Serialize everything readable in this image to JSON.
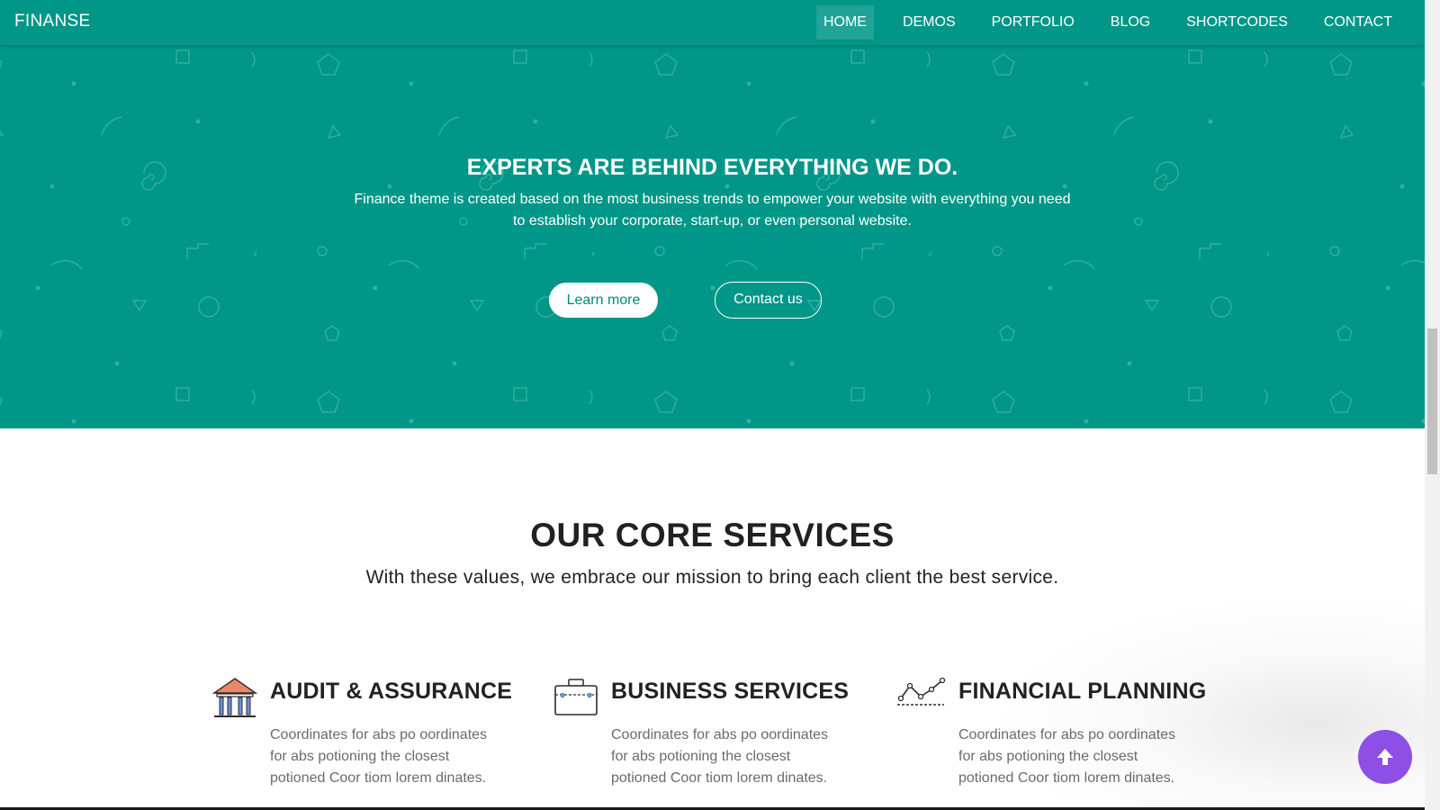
{
  "brand": "FINANSE",
  "nav": {
    "items": [
      "HOME",
      "DEMOS",
      "PORTFOLIO",
      "BLOG",
      "SHORTCODES",
      "CONTACT"
    ],
    "active": "HOME"
  },
  "hero": {
    "title": "EXPERTS ARE BEHIND EVERYTHING WE DO.",
    "text": "Finance theme is created based on the most business trends to empower your website with everything you need to establish your corporate, start-up, or even personal website.",
    "learn_more_label": "Learn more",
    "contact_label": "Contact us"
  },
  "services": {
    "title": "OUR CORE SERVICES",
    "subtitle": "With these values, we embrace our mission to bring each client the best service.",
    "items": [
      {
        "icon": "bank-icon",
        "title": "AUDIT & ASSURANCE",
        "text": "Coordinates for abs po oordinates for abs potioning the closest potioned Coor tiom lorem dinates."
      },
      {
        "icon": "briefcase-icon",
        "title": "BUSINESS SERVICES",
        "text": "Coordinates for abs po oordinates for abs potioning the closest potioned Coor tiom lorem dinates."
      },
      {
        "icon": "line-chart-icon",
        "title": "FINANCIAL PLANNING",
        "text": "Coordinates for abs po oordinates for abs potioning the closest potioned Coor tiom lorem dinates."
      }
    ]
  },
  "scroll_top_icon": "arrow-up-icon",
  "colors": {
    "primary": "#009688",
    "accent_fab": "#8e4fe6",
    "heading": "#212121",
    "body_text": "#6b6b6b"
  }
}
